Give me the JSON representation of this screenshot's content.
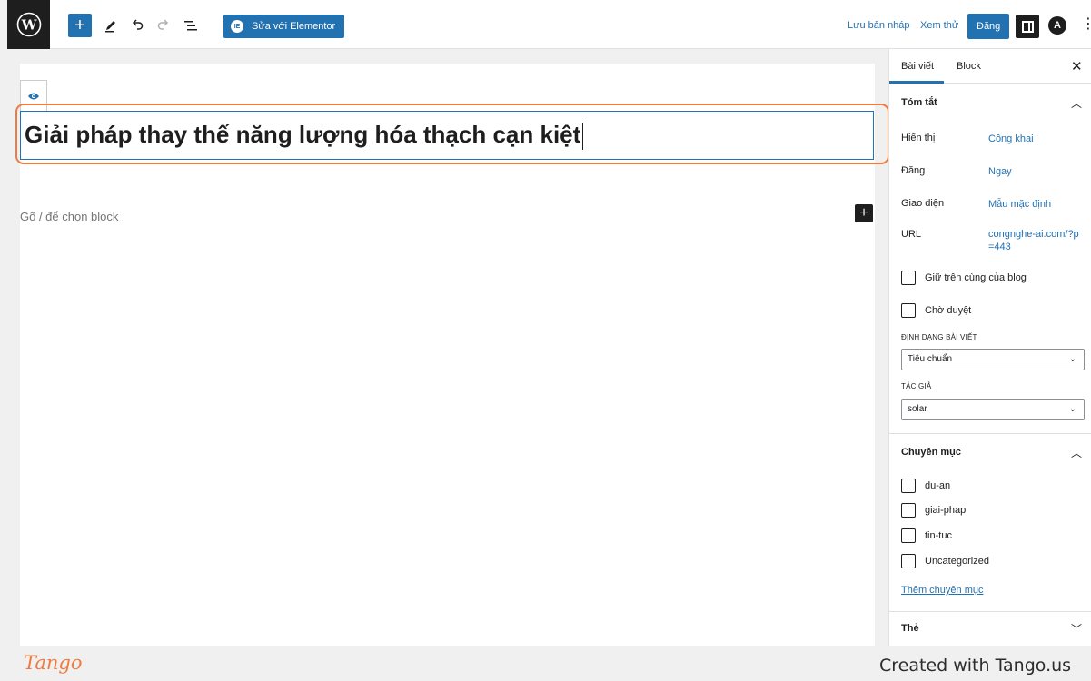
{
  "topbar": {
    "add_icon": "plus-icon",
    "edit_icon": "pencil-icon",
    "undo_icon": "undo-icon",
    "redo_icon": "redo-icon",
    "list_icon": "list-view-icon",
    "elementor_label": "Sửa với Elementor",
    "save_draft_label": "Lưu bản nháp",
    "preview_label": "Xem thử",
    "publish_label": "Đăng"
  },
  "editor": {
    "title": "Giải pháp thay thế năng lượng hóa thạch cạn kiệt",
    "block_placeholder": "Gõ / để chọn block"
  },
  "sidebar": {
    "tabs": [
      {
        "label": "Bài viết",
        "active": true
      },
      {
        "label": "Block",
        "active": false
      }
    ],
    "summary": {
      "title": "Tóm tắt",
      "rows": [
        {
          "label": "Hiển thị",
          "value": "Công khai"
        },
        {
          "label": "Đăng",
          "value": "Ngay"
        },
        {
          "label": "Giao diện",
          "value": "Mẫu mặc định"
        },
        {
          "label": "URL",
          "value": "congnghe-ai.com/?p=443"
        }
      ],
      "sticky_label": "Giữ trên cùng của blog",
      "pending_label": "Chờ duyệt",
      "format_label": "ĐỊNH DẠNG BÀI VIẾT",
      "format_value": "Tiêu chuẩn",
      "author_label": "TÁC GIẢ",
      "author_value": "solar"
    },
    "categories": {
      "title": "Chuyên mục",
      "items": [
        "du-an",
        "giai-phap",
        "tin-tuc",
        "Uncategorized"
      ],
      "add_label": "Thêm chuyên mục"
    },
    "tags": {
      "title": "Thẻ"
    }
  },
  "footer": {
    "logo": "Tango",
    "credit": "Created with Tango.us"
  },
  "colors": {
    "accent": "#2271b1",
    "highlight": "#f07b3f"
  }
}
